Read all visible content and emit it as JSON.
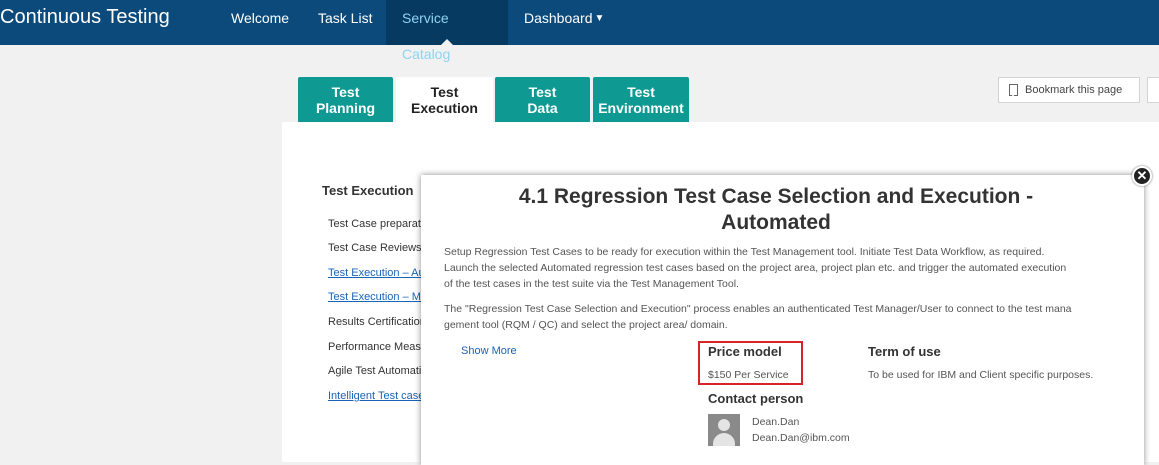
{
  "app": {
    "title": "Continuous Testing"
  },
  "nav": {
    "items": [
      {
        "label": "Welcome"
      },
      {
        "label": "Task List"
      },
      {
        "label": "Service Catalog"
      },
      {
        "label": "Dashboard"
      }
    ],
    "active": "Service Catalog",
    "dropdown_icon": "chevron-down-icon"
  },
  "tabs": [
    {
      "line1": "Test",
      "line2": "Planning"
    },
    {
      "line1": "Test",
      "line2": "Execution"
    },
    {
      "line1": "Test",
      "line2": "Data"
    },
    {
      "line1": "Test",
      "line2": "Environment"
    }
  ],
  "active_tab": "Test Execution",
  "toolbar": {
    "bookmark_label": "Bookmark this page"
  },
  "catalog": {
    "section_title": "Test Execution",
    "items": [
      {
        "label": "Test Case preparation",
        "link": false
      },
      {
        "label": "Test Case Reviews",
        "link": false
      },
      {
        "label": "Test Execution – Automated",
        "link": true
      },
      {
        "label": "Test Execution – Manual",
        "link": true
      },
      {
        "label": "Results Certification",
        "link": false
      },
      {
        "label": "Performance Measurement",
        "link": false
      },
      {
        "label": "Agile Test Automation",
        "link": false
      },
      {
        "label": "Intelligent Test case",
        "link": true
      }
    ]
  },
  "modal": {
    "title_line1": "4.1 Regression Test Case Selection and Execution -",
    "title_line2": "Automated",
    "desc1_line1": "Setup Regression Test Cases to be ready for execution within the Test Management tool. Initiate Test Data Workflow, as required.",
    "desc1_line2": "Launch the selected Automated regression test cases based on the project area, project plan etc. and trigger the automated execution",
    "desc1_line3": "of the test cases in the test suite via the Test Management Tool.",
    "desc2_line1": "The \"Regression Test Case Selection and Execution\" process enables an authenticated Test Manager/User to connect to the test mana",
    "desc2_line2": "gement tool (RQM / QC) and select the project area/ domain.",
    "show_more": "Show More",
    "price_label": "Price model",
    "price_value": "$150 Per Service",
    "term_label": "Term of use",
    "term_value": "To be used for IBM and Client specific purposes.",
    "contact_label": "Contact person",
    "contact_name": "Dean.Dan",
    "contact_email": "Dean.Dan@ibm.com",
    "close_icon": "close-icon",
    "highlight_color": "#d8232a"
  },
  "colors": {
    "nav_bg": "#0b4a7a",
    "tab_bg": "#0e9a93",
    "link": "#1a63b6"
  }
}
